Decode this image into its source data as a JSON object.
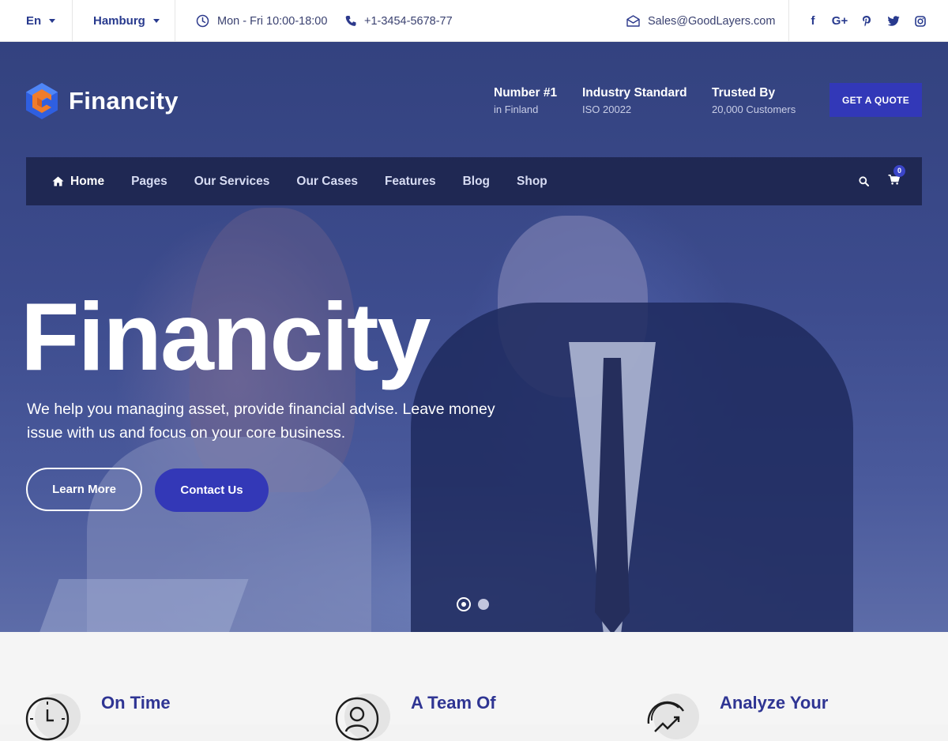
{
  "topbar": {
    "language": "En",
    "city": "Hamburg",
    "hours": "Mon - Fri 10:00-18:00",
    "phone": "+1-3454-5678-77",
    "email": "Sales@GoodLayers.com",
    "social": [
      "facebook-icon",
      "google-plus-icon",
      "pinterest-icon",
      "twitter-icon",
      "instagram-icon"
    ]
  },
  "header": {
    "logo_text": "Financity",
    "stats": [
      {
        "title": "Number #1",
        "sub": "in Finland"
      },
      {
        "title": "Industry Standard",
        "sub": "ISO 20022"
      },
      {
        "title": "Trusted By",
        "sub": "20,000 Customers"
      }
    ],
    "quote_button": "GET A QUOTE"
  },
  "nav": {
    "items": [
      "Home",
      "Pages",
      "Our Services",
      "Our Cases",
      "Features",
      "Blog",
      "Shop"
    ],
    "active": "Home",
    "cart_count": "0"
  },
  "hero": {
    "title": "Financity",
    "text": "We help you managing asset, provide financial advise. Leave money issue with us and focus on your core business.",
    "learn_more": "Learn More",
    "contact_us": "Contact Us",
    "slides": 2,
    "active_slide": 1
  },
  "features": [
    {
      "title": "On Time",
      "icon": "clock-icon"
    },
    {
      "title": "A Team Of",
      "icon": "team-icon"
    },
    {
      "title": "Analyze Your",
      "icon": "chart-icon"
    }
  ],
  "colors": {
    "brand": "#3238b8",
    "navy": "#283a8e",
    "nav_bg": "#1a2148",
    "feature_title": "#2f3593"
  }
}
